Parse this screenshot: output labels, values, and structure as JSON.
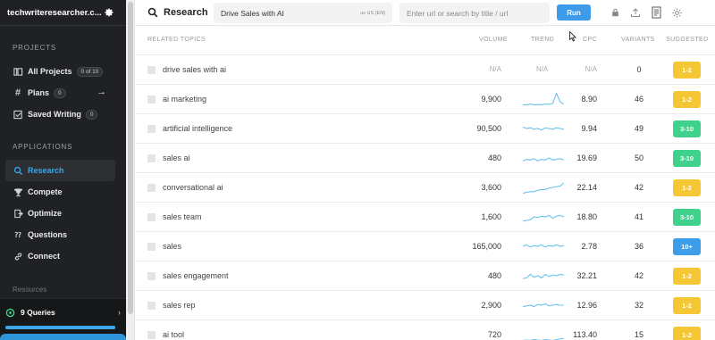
{
  "sidebar": {
    "site_name": "techwriteresearcher.c...",
    "projects_heading": "PROJECTS",
    "projects": [
      {
        "label": "All Projects",
        "badge": "0 of 10",
        "icon": "folder-icon"
      },
      {
        "label": "Plans",
        "badge": "0",
        "icon": "hash-icon",
        "arrow": "→"
      },
      {
        "label": "Saved Writing",
        "badge": "0",
        "icon": "edit-check-icon"
      }
    ],
    "applications_heading": "APPLICATIONS",
    "applications": [
      {
        "label": "Research",
        "icon": "search-icon",
        "active": true
      },
      {
        "label": "Compete",
        "icon": "trophy-icon"
      },
      {
        "label": "Optimize",
        "icon": "export-icon"
      },
      {
        "label": "Questions",
        "icon": "question-icon"
      },
      {
        "label": "Connect",
        "icon": "link-icon"
      }
    ],
    "hidden_item": "Resources",
    "queries": {
      "label": "9 Queries",
      "progress": 1.0
    }
  },
  "topbar": {
    "title": "Research",
    "keyword_value": "Drive Sales with AI",
    "locale": "us US (EN)",
    "url_placeholder": "Enter url or search by title / url",
    "run_label": "Run",
    "icons": [
      "lock-icon",
      "upload-icon",
      "document-icon",
      "gear-icon"
    ]
  },
  "table": {
    "headers": {
      "topic": "RELATED TOPICS",
      "volume": "VOLUME",
      "trend": "TREND",
      "cpc": "CPC",
      "variants": "VARIANTS",
      "suggested": "SUGGESTED"
    },
    "rows": [
      {
        "topic": "drive sales with ai",
        "volume": "N/A",
        "trend": "N/A",
        "cpc": "N/A",
        "variants": "0",
        "suggested": "1-2",
        "color": "yellow"
      },
      {
        "topic": "ai marketing",
        "volume": "9,900",
        "trend": [
          0.1,
          0.1,
          0.15,
          0.1,
          0.12,
          0.1,
          0.15,
          0.12,
          0.2,
          0.9,
          0.3,
          0.15
        ],
        "cpc": "8.90",
        "variants": "46",
        "suggested": "1-2",
        "color": "yellow"
      },
      {
        "topic": "artificial intelligence",
        "volume": "90,500",
        "trend": [
          0.6,
          0.5,
          0.55,
          0.45,
          0.5,
          0.4,
          0.55,
          0.5,
          0.45,
          0.55,
          0.5,
          0.45
        ],
        "cpc": "9.94",
        "variants": "49",
        "suggested": "3-10",
        "color": "green"
      },
      {
        "topic": "sales ai",
        "volume": "480",
        "trend": [
          0.3,
          0.4,
          0.35,
          0.45,
          0.3,
          0.4,
          0.35,
          0.5,
          0.35,
          0.4,
          0.45,
          0.35
        ],
        "cpc": "19.69",
        "variants": "50",
        "suggested": "3-10",
        "color": "green"
      },
      {
        "topic": "conversational ai",
        "volume": "3,600",
        "trend": [
          0.1,
          0.15,
          0.2,
          0.2,
          0.3,
          0.35,
          0.35,
          0.45,
          0.5,
          0.55,
          0.6,
          0.8
        ],
        "cpc": "22.14",
        "variants": "42",
        "suggested": "1-2",
        "color": "yellow"
      },
      {
        "topic": "sales team",
        "volume": "1,600",
        "trend": [
          0.2,
          0.25,
          0.3,
          0.5,
          0.45,
          0.55,
          0.5,
          0.6,
          0.4,
          0.55,
          0.6,
          0.5
        ],
        "cpc": "18.80",
        "variants": "41",
        "suggested": "3-10",
        "color": "green"
      },
      {
        "topic": "sales",
        "volume": "165,000",
        "trend": [
          0.5,
          0.6,
          0.45,
          0.55,
          0.5,
          0.6,
          0.45,
          0.55,
          0.5,
          0.6,
          0.5,
          0.55
        ],
        "cpc": "2.78",
        "variants": "36",
        "suggested": "10+",
        "color": "blue"
      },
      {
        "topic": "sales engagement",
        "volume": "480",
        "trend": [
          0.3,
          0.35,
          0.6,
          0.4,
          0.5,
          0.35,
          0.6,
          0.45,
          0.55,
          0.5,
          0.6,
          0.55
        ],
        "cpc": "32.21",
        "variants": "42",
        "suggested": "1-2",
        "color": "yellow"
      },
      {
        "topic": "sales rep",
        "volume": "2,900",
        "trend": [
          0.4,
          0.45,
          0.5,
          0.4,
          0.55,
          0.5,
          0.6,
          0.45,
          0.5,
          0.55,
          0.5,
          0.5
        ],
        "cpc": "12.96",
        "variants": "32",
        "suggested": "1-2",
        "color": "yellow"
      },
      {
        "topic": "ai tool",
        "volume": "720",
        "trend": [
          0.1,
          0.12,
          0.1,
          0.15,
          0.12,
          0.1,
          0.15,
          0.12,
          0.1,
          0.15,
          0.2,
          0.25
        ],
        "cpc": "113.40",
        "variants": "15",
        "suggested": "1-2",
        "color": "yellow"
      }
    ]
  },
  "colors": {
    "accent": "#3d9be9",
    "yellow": "#f6c734",
    "green": "#3fd28c",
    "blue": "#3c9ee8",
    "sparkline": "#6cc3ec"
  }
}
